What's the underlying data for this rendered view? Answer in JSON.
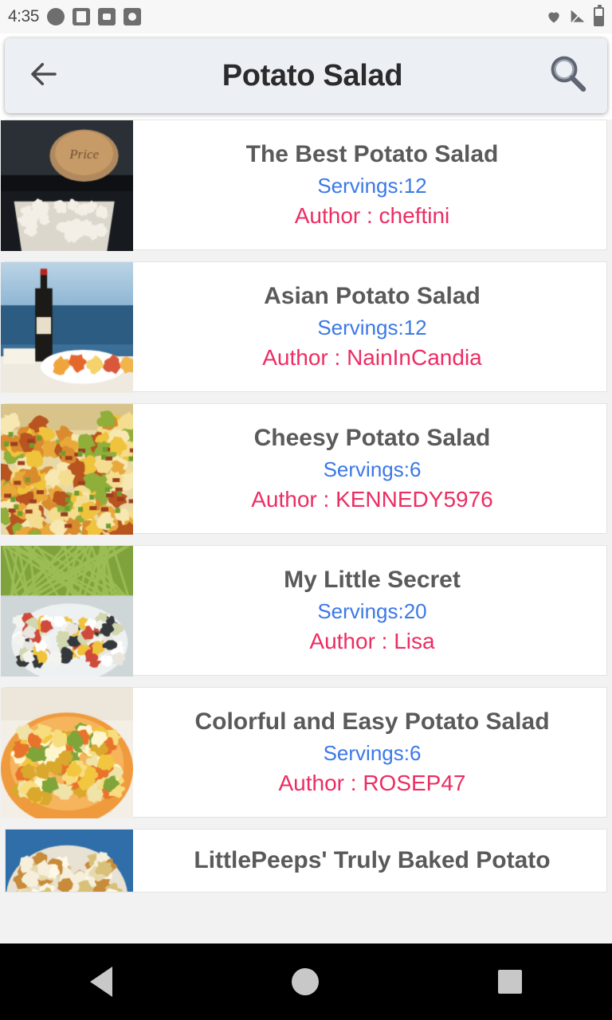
{
  "status_bar": {
    "clock": "4:35",
    "left_icons": [
      "alarm-icon",
      "document-icon",
      "camera-icon",
      "circle-app-icon"
    ],
    "right_icons": [
      "heart-icon",
      "signal-icon",
      "battery-icon"
    ]
  },
  "search_bar": {
    "back_icon": "back-arrow-icon",
    "title": "Potato Salad",
    "search_icon": "magnifier-icon"
  },
  "results": [
    {
      "title": "The Best Potato Salad",
      "servings": "Servings:12",
      "author": "Author : cheftini",
      "thumb": "potato-salad-container-photo"
    },
    {
      "title": "Asian Potato Salad",
      "servings": "Servings:12",
      "author": "Author : NainInCandia",
      "thumb": "wine-bottle-seaside-photo"
    },
    {
      "title": "Cheesy Potato Salad",
      "servings": "Servings:6",
      "author": "Author : KENNEDY5976",
      "thumb": "cheesy-potato-salad-photo"
    },
    {
      "title": "My Little Secret",
      "servings": "Servings:20",
      "author": "Author : Lisa",
      "thumb": "creamy-salad-bowl-photo"
    },
    {
      "title": "Colorful and Easy Potato Salad",
      "servings": "Servings:6",
      "author": "Author : ROSEP47",
      "thumb": "colorful-potato-salad-photo"
    },
    {
      "title": "LittlePeeps' Truly Baked Potato",
      "servings": "",
      "author": "",
      "thumb": "baked-potato-dish-photo"
    }
  ],
  "nav_bar": {
    "back": "nav-back-icon",
    "home": "nav-home-icon",
    "recents": "nav-recents-icon"
  },
  "colors": {
    "servings": "#3b78e7",
    "author": "#ec2d62",
    "title": "#5a5a5a",
    "searchbar_bg": "#eceff4"
  }
}
